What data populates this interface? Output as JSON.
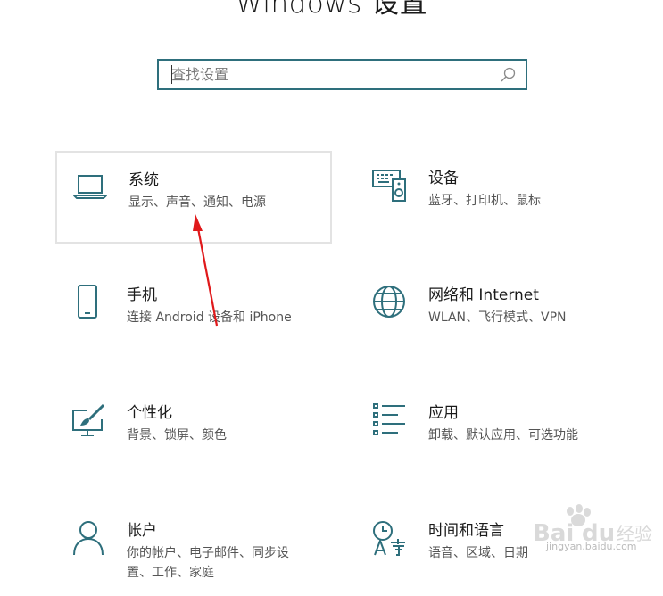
{
  "page": {
    "title": "Windows 设置"
  },
  "search": {
    "placeholder": "查找设置",
    "value": ""
  },
  "tiles": [
    {
      "id": "system",
      "icon": "laptop-icon",
      "title": "系统",
      "desc": "显示、声音、通知、电源",
      "selected": true
    },
    {
      "id": "devices",
      "icon": "keyboard-speaker-icon",
      "title": "设备",
      "desc": "蓝牙、打印机、鼠标",
      "selected": false
    },
    {
      "id": "phone",
      "icon": "phone-icon",
      "title": "手机",
      "desc": "连接 Android 设备和 iPhone",
      "selected": false
    },
    {
      "id": "network",
      "icon": "globe-icon",
      "title": "网络和 Internet",
      "desc": "WLAN、飞行模式、VPN",
      "selected": false
    },
    {
      "id": "personalization",
      "icon": "paintbrush-monitor-icon",
      "title": "个性化",
      "desc": "背景、锁屏、颜色",
      "selected": false
    },
    {
      "id": "apps",
      "icon": "app-list-icon",
      "title": "应用",
      "desc": "卸载、默认应用、可选功能",
      "selected": false
    },
    {
      "id": "accounts",
      "icon": "person-icon",
      "title": "帐户",
      "desc_line1": "你的帐户、电子邮件、同步设",
      "desc_line2": "置、工作、家庭",
      "selected": false
    },
    {
      "id": "time-language",
      "icon": "clock-language-icon",
      "title": "时间和语言",
      "desc": "语音、区域、日期",
      "selected": false
    }
  ],
  "watermark": {
    "brand": "Baidu 经验",
    "url": "jingyan.baidu.com"
  },
  "colors": {
    "accent": "#2e6f7c",
    "arrow": "#e0191b",
    "selection_border": "#e3e3e3"
  }
}
